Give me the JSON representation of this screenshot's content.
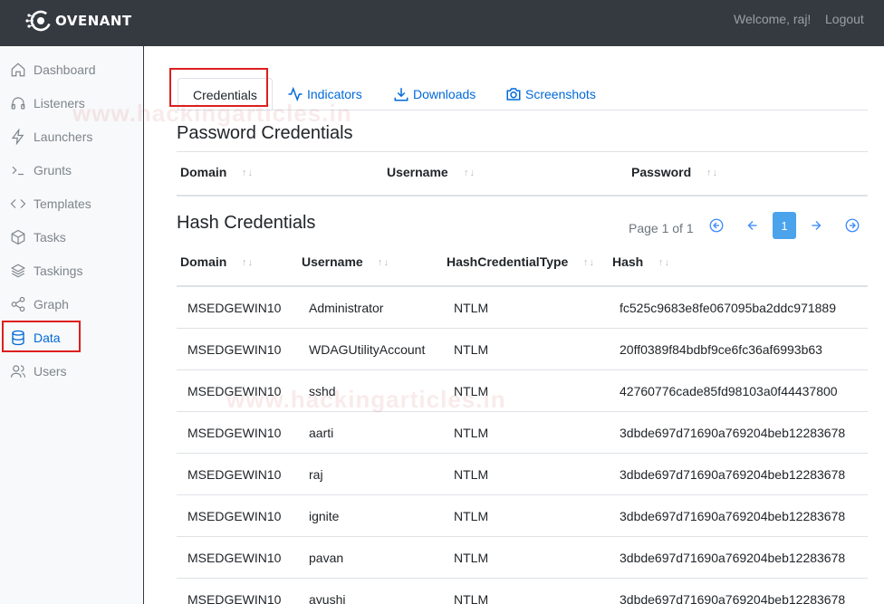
{
  "header": {
    "logo_text": "OVENANT",
    "welcome": "Welcome, raj!",
    "logout": "Logout"
  },
  "sidebar": {
    "items": [
      {
        "label": "Dashboard",
        "icon": "home-icon"
      },
      {
        "label": "Listeners",
        "icon": "headphones-icon"
      },
      {
        "label": "Launchers",
        "icon": "lightning-icon"
      },
      {
        "label": "Grunts",
        "icon": "terminal-icon"
      },
      {
        "label": "Templates",
        "icon": "code-icon"
      },
      {
        "label": "Tasks",
        "icon": "box-icon"
      },
      {
        "label": "Taskings",
        "icon": "layers-icon"
      },
      {
        "label": "Graph",
        "icon": "share-icon"
      },
      {
        "label": "Data",
        "icon": "database-icon",
        "active": true
      },
      {
        "label": "Users",
        "icon": "users-icon"
      }
    ]
  },
  "tabs": [
    {
      "label": "Credentials",
      "active": true
    },
    {
      "label": "Indicators",
      "icon": "activity-icon"
    },
    {
      "label": "Downloads",
      "icon": "download-icon"
    },
    {
      "label": "Screenshots",
      "icon": "camera-icon"
    }
  ],
  "password_section": {
    "title": "Password Credentials",
    "columns": [
      "Domain",
      "Username",
      "Password"
    ],
    "sort_glyph": "↑↓"
  },
  "hash_section": {
    "title": "Hash Credentials",
    "columns": [
      "Domain",
      "Username",
      "HashCredentialType",
      "Hash"
    ],
    "pager": {
      "text": "Page 1 of 1",
      "current": "1"
    },
    "rows": [
      [
        "MSEDGEWIN10",
        "Administrator",
        "NTLM",
        "fc525c9683e8fe067095ba2ddc971889"
      ],
      [
        "MSEDGEWIN10",
        "WDAGUtilityAccount",
        "NTLM",
        "20ff0389f84bdbf9ce6fc36af6993b63"
      ],
      [
        "MSEDGEWIN10",
        "sshd",
        "NTLM",
        "42760776cade85fd98103a0f44437800"
      ],
      [
        "MSEDGEWIN10",
        "aarti",
        "NTLM",
        "3dbde697d71690a769204beb12283678"
      ],
      [
        "MSEDGEWIN10",
        "raj",
        "NTLM",
        "3dbde697d71690a769204beb12283678"
      ],
      [
        "MSEDGEWIN10",
        "ignite",
        "NTLM",
        "3dbde697d71690a769204beb12283678"
      ],
      [
        "MSEDGEWIN10",
        "pavan",
        "NTLM",
        "3dbde697d71690a769204beb12283678"
      ],
      [
        "MSEDGEWIN10",
        "ayushi",
        "NTLM",
        "3dbde697d71690a769204beb12283678"
      ]
    ]
  },
  "watermark": "www.hackingarticles.in",
  "colors": {
    "accent": "#0069d9",
    "highlight": "#dc1f1f",
    "header_bg": "#343a40"
  }
}
